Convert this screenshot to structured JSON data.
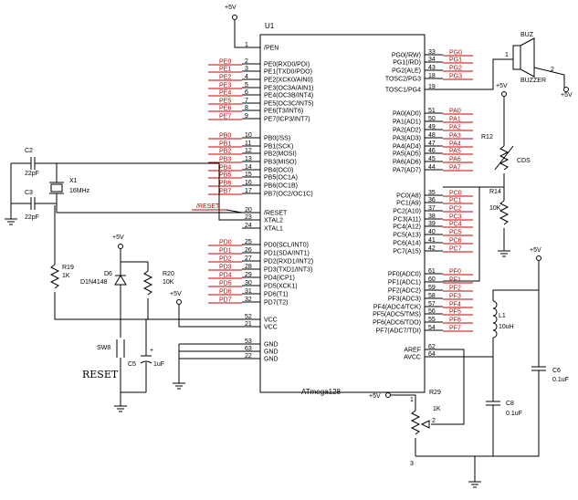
{
  "supply": {
    "p5v": "+5V"
  },
  "u1": {
    "ref": "U1",
    "part": "ATmega128",
    "left": [
      {
        "n": "1",
        "name": "/PEN",
        "net": ""
      },
      {
        "n": "2",
        "name": "PE0(RXD0/PDI)",
        "net": "PE0"
      },
      {
        "n": "3",
        "name": "PE1(TXD0/PDO)",
        "net": "PE1"
      },
      {
        "n": "4",
        "name": "PE2(XCK0/AIN0)",
        "net": "PE2"
      },
      {
        "n": "5",
        "name": "PE3(OC3A/AIN1)",
        "net": "PE3"
      },
      {
        "n": "6",
        "name": "PE4(OC3B/INT4)",
        "net": "PE4"
      },
      {
        "n": "7",
        "name": "PE5(OC3C/INT5)",
        "net": "PE5"
      },
      {
        "n": "8",
        "name": "PE6(T3/INT6)",
        "net": "PE6"
      },
      {
        "n": "9",
        "name": "PE7(ICP3/INT7)",
        "net": "PE7"
      },
      {
        "n": "10",
        "name": "PB0(/SS)",
        "net": "PB0"
      },
      {
        "n": "11",
        "name": "PB1(SCK)",
        "net": "PB1"
      },
      {
        "n": "12",
        "name": "PB2(MOSI)",
        "net": "PB2"
      },
      {
        "n": "13",
        "name": "PB3(MISO)",
        "net": "PB3"
      },
      {
        "n": "14",
        "name": "PB4(OC0)",
        "net": "PB4"
      },
      {
        "n": "15",
        "name": "PB5(OC1A)",
        "net": "PB5"
      },
      {
        "n": "16",
        "name": "PB6(OC1B)",
        "net": "PB6"
      },
      {
        "n": "17",
        "name": "PB7(OC2/OC1C)",
        "net": "PB7"
      },
      {
        "n": "20",
        "name": "/RESET",
        "net": "/RESET"
      },
      {
        "n": "23",
        "name": "XTAL2",
        "net": ""
      },
      {
        "n": "24",
        "name": "XTAL1",
        "net": ""
      },
      {
        "n": "25",
        "name": "PD0(SCL/INT0)",
        "net": "PD0"
      },
      {
        "n": "26",
        "name": "PD1(SDA/INT1)",
        "net": "PD1"
      },
      {
        "n": "27",
        "name": "PD2(RXD1/INT2)",
        "net": "PD2"
      },
      {
        "n": "28",
        "name": "PD3(TXD1/INT3)",
        "net": "PD3"
      },
      {
        "n": "29",
        "name": "PD4(ICP1)",
        "net": "PD4"
      },
      {
        "n": "30",
        "name": "PD5(XCK1)",
        "net": "PD5"
      },
      {
        "n": "31",
        "name": "PD6(T1)",
        "net": "PD6"
      },
      {
        "n": "32",
        "name": "PD7(T2)",
        "net": "PD7"
      },
      {
        "n": "52",
        "name": "VCC",
        "net": ""
      },
      {
        "n": "21",
        "name": "VCC",
        "net": ""
      },
      {
        "n": "53",
        "name": "GND",
        "net": ""
      },
      {
        "n": "63",
        "name": "GND",
        "net": ""
      },
      {
        "n": "22",
        "name": "GND",
        "net": ""
      }
    ],
    "right": [
      {
        "n": "33",
        "name": "PG0(/RW)",
        "net": "PG0"
      },
      {
        "n": "34",
        "name": "PG1(/RD)",
        "net": "PG1"
      },
      {
        "n": "43",
        "name": "PG2(ALE)",
        "net": "PG2"
      },
      {
        "n": "18",
        "name": "TOSC2/PG3",
        "net": "PG3"
      },
      {
        "n": "19",
        "name": "TOSC1/PG4",
        "net": ""
      },
      {
        "n": "51",
        "name": "PA0(AD0)",
        "net": "PA0"
      },
      {
        "n": "50",
        "name": "PA1(AD1)",
        "net": "PA1"
      },
      {
        "n": "49",
        "name": "PA2(AD2)",
        "net": "PA2"
      },
      {
        "n": "48",
        "name": "PA3(AD3)",
        "net": "PA3"
      },
      {
        "n": "47",
        "name": "PA4(AD4)",
        "net": "PA4"
      },
      {
        "n": "46",
        "name": "PA5(AD5)",
        "net": "PA5"
      },
      {
        "n": "45",
        "name": "PA6(AD6)",
        "net": "PA6"
      },
      {
        "n": "44",
        "name": "PA7(AD7)",
        "net": "PA7"
      },
      {
        "n": "35",
        "name": "PC0(A8)",
        "net": "PC0"
      },
      {
        "n": "36",
        "name": "PC1(A9)",
        "net": "PC1"
      },
      {
        "n": "37",
        "name": "PC2(A10)",
        "net": "PC2"
      },
      {
        "n": "38",
        "name": "PC3(A11)",
        "net": "PC3"
      },
      {
        "n": "39",
        "name": "PC4(A12)",
        "net": "PC4"
      },
      {
        "n": "40",
        "name": "PC5(A13)",
        "net": "PC5"
      },
      {
        "n": "41",
        "name": "PC6(A14)",
        "net": "PC6"
      },
      {
        "n": "42",
        "name": "PC7(A15)",
        "net": "PC7"
      },
      {
        "n": "61",
        "name": "PF0(ADC0)",
        "net": "PF0"
      },
      {
        "n": "60",
        "name": "PF1(ADC1)",
        "net": "PF1"
      },
      {
        "n": "59",
        "name": "PF2(ADC2)",
        "net": "PF2"
      },
      {
        "n": "58",
        "name": "PF3(ADC3)",
        "net": "PF3"
      },
      {
        "n": "57",
        "name": "PF4(ADC4/TCK)",
        "net": "PF4"
      },
      {
        "n": "56",
        "name": "PF5(ADC5/TMS)",
        "net": "PF5"
      },
      {
        "n": "55",
        "name": "PF6(ADC6/TDO)",
        "net": "PF6"
      },
      {
        "n": "54",
        "name": "PF7(ADC7/TDI)",
        "net": "PF7"
      },
      {
        "n": "62",
        "name": "AREF",
        "net": ""
      },
      {
        "n": "64",
        "name": "AVCC",
        "net": ""
      }
    ]
  },
  "components": {
    "c2": {
      "ref": "C2",
      "val": "22pF"
    },
    "c3": {
      "ref": "C3",
      "val": "22pF"
    },
    "x1": {
      "ref": "X1",
      "val": "16MHz"
    },
    "r19": {
      "ref": "R19",
      "val": "1K"
    },
    "d6": {
      "ref": "D6",
      "val": "D1N4148"
    },
    "r20": {
      "ref": "R20",
      "val": "10K"
    },
    "sw8": {
      "ref": "SW8",
      "val": "RESET"
    },
    "c5": {
      "ref": "C5",
      "val": "1uF",
      "plus": "+"
    },
    "buz": {
      "ref": "BUZ",
      "val": "BUZZER",
      "p1": "1",
      "p2": "2"
    },
    "r12": {
      "ref": "R12",
      "val": "CDS"
    },
    "r14": {
      "ref": "R14",
      "val": "10K"
    },
    "l1": {
      "ref": "L1",
      "val": "10uH"
    },
    "c6": {
      "ref": "C6",
      "val": "0.1uF"
    },
    "c8": {
      "ref": "C8",
      "val": "0.1uF"
    },
    "r29": {
      "ref": "R29",
      "val": "1K",
      "p1": "1",
      "p2": "2",
      "p3": "3"
    }
  },
  "nets": {
    "reset": "/RESET"
  }
}
